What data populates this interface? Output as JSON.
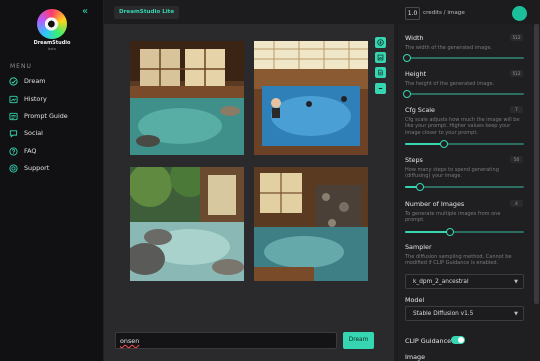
{
  "app": {
    "logo_title": "DreamStudio",
    "logo_sub": "beta",
    "version_tag": "DreamStudio Lite"
  },
  "sidebar": {
    "menu_heading": "MENU",
    "items": [
      {
        "label": "Dream",
        "icon": "dream-icon"
      },
      {
        "label": "History",
        "icon": "history-icon"
      },
      {
        "label": "Prompt Guide",
        "icon": "guide-icon"
      },
      {
        "label": "Social",
        "icon": "social-icon"
      },
      {
        "label": "FAQ",
        "icon": "faq-icon"
      },
      {
        "label": "Support",
        "icon": "support-icon"
      }
    ]
  },
  "header": {
    "credits_value": "1.0",
    "credits_label": "credits / image"
  },
  "prompt": {
    "value": "onsen",
    "button_label": "Dream"
  },
  "tools": [
    "download-icon",
    "image-icon",
    "file-icon",
    "minus-icon"
  ],
  "settings": {
    "width": {
      "title": "Width",
      "desc": "The width of the generated image.",
      "value": "512",
      "fraction": 0.02
    },
    "height": {
      "title": "Height",
      "desc": "The height of the generated image.",
      "value": "512",
      "fraction": 0.02
    },
    "cfg": {
      "title": "Cfg Scale",
      "desc": "Cfg scale adjusts how much the image will be like your prompt. Higher values keep your image closer to your prompt.",
      "value": "7",
      "fraction": 0.33
    },
    "steps": {
      "title": "Steps",
      "desc": "How many steps to spend generating (diffusing) your image.",
      "value": "50",
      "fraction": 0.13
    },
    "num_images": {
      "title": "Number of Images",
      "desc": "To generate multiple images from one prompt.",
      "value": "4",
      "fraction": 0.38
    },
    "sampler": {
      "title": "Sampler",
      "desc": "The diffusion sampling method. Cannot be modified if CLIP Guidance is enabled.",
      "value": "k_dpm_2_ancestral"
    },
    "model": {
      "title": "Model",
      "value": "Stable Diffusion v1.5"
    },
    "clip": {
      "title": "CLIP Guidance",
      "enabled": true
    },
    "image": {
      "title": "Image"
    }
  },
  "colors": {
    "accent": "#36d6b2",
    "sidebar_bg": "#111113",
    "canvas_bg": "#2a2a2c"
  }
}
